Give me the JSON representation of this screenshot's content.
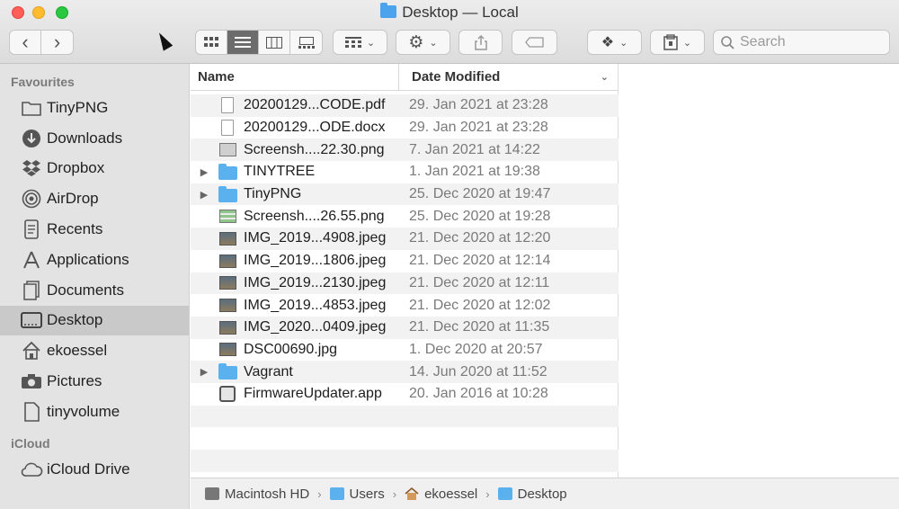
{
  "window": {
    "title": "Desktop — Local"
  },
  "toolbar": {
    "nav_back": "‹",
    "nav_forward": "›",
    "search_placeholder": "Search"
  },
  "sidebar": {
    "favourites_label": "Favourites",
    "icloud_label": "iCloud",
    "items": [
      {
        "label": "TinyPNG",
        "icon": "folder-icon"
      },
      {
        "label": "Downloads",
        "icon": "downloads-icon"
      },
      {
        "label": "Dropbox",
        "icon": "dropbox-icon"
      },
      {
        "label": "AirDrop",
        "icon": "airdrop-icon"
      },
      {
        "label": "Recents",
        "icon": "clock-icon"
      },
      {
        "label": "Applications",
        "icon": "applications-icon"
      },
      {
        "label": "Documents",
        "icon": "documents-icon"
      },
      {
        "label": "Desktop",
        "icon": "desktop-icon",
        "selected": true
      },
      {
        "label": "ekoessel",
        "icon": "home-icon"
      },
      {
        "label": "Pictures",
        "icon": "camera-icon"
      },
      {
        "label": "tinyvolume",
        "icon": "file-icon"
      }
    ],
    "icloud_items": [
      {
        "label": "iCloud Drive",
        "icon": "cloud-icon"
      }
    ]
  },
  "columns": {
    "name": "Name",
    "date_modified": "Date Modified"
  },
  "files": [
    {
      "name": "20200129...CODE.pdf",
      "date": "29. Jan 2021 at 23:28",
      "kind": "doc"
    },
    {
      "name": "20200129...ODE.docx",
      "date": "29. Jan 2021 at 23:28",
      "kind": "doc"
    },
    {
      "name": "Screensh....22.30.png",
      "date": "7. Jan 2021 at 14:22",
      "kind": "png"
    },
    {
      "name": "TINYTREE",
      "date": "1. Jan 2021 at 19:38",
      "kind": "folder"
    },
    {
      "name": "TinyPNG",
      "date": "25. Dec 2020 at 19:47",
      "kind": "folder"
    },
    {
      "name": "Screensh....26.55.png",
      "date": "25. Dec 2020 at 19:28",
      "kind": "pngg"
    },
    {
      "name": "IMG_2019...4908.jpeg",
      "date": "21. Dec 2020 at 12:20",
      "kind": "img"
    },
    {
      "name": "IMG_2019...1806.jpeg",
      "date": "21. Dec 2020 at 12:14",
      "kind": "img"
    },
    {
      "name": "IMG_2019...2130.jpeg",
      "date": "21. Dec 2020 at 12:11",
      "kind": "img"
    },
    {
      "name": "IMG_2019...4853.jpeg",
      "date": "21. Dec 2020 at 12:02",
      "kind": "img"
    },
    {
      "name": "IMG_2020...0409.jpeg",
      "date": "21. Dec 2020 at 11:35",
      "kind": "img"
    },
    {
      "name": "DSC00690.jpg",
      "date": "1. Dec 2020 at 20:57",
      "kind": "img"
    },
    {
      "name": "Vagrant",
      "date": "14. Jun 2020 at 11:52",
      "kind": "folder"
    },
    {
      "name": "FirmwareUpdater.app",
      "date": "20. Jan 2016 at 10:28",
      "kind": "app"
    }
  ],
  "pathbar": [
    {
      "label": "Macintosh HD",
      "icon": "harddisk-icon"
    },
    {
      "label": "Users",
      "icon": "folder-icon"
    },
    {
      "label": "ekoessel",
      "icon": "home-icon"
    },
    {
      "label": "Desktop",
      "icon": "folder-icon"
    }
  ]
}
